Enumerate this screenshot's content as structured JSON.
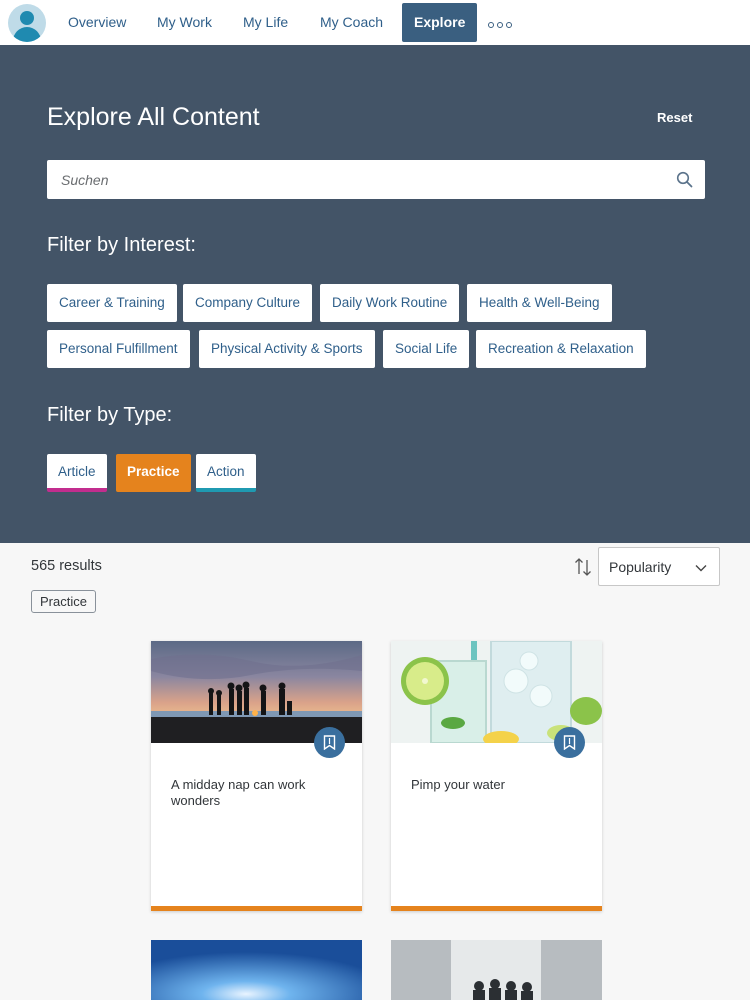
{
  "nav": {
    "tabs": [
      {
        "label": "Overview"
      },
      {
        "label": "My Work"
      },
      {
        "label": "My Life"
      },
      {
        "label": "My Coach"
      },
      {
        "label": "Explore"
      }
    ],
    "active_tab": "Explore",
    "more_icon": "overflow-dots-icon"
  },
  "hero": {
    "title": "Explore All Content",
    "reset_label": "Reset",
    "search": {
      "placeholder": "Suchen",
      "value": ""
    },
    "interest_label": "Filter by Interest:",
    "interests": [
      "Career & Training",
      "Company Culture",
      "Daily Work Routine",
      "Health & Well-Being",
      "Personal Fulfillment",
      "Physical Activity & Sports",
      "Social Life",
      "Recreation & Relaxation"
    ],
    "type_label": "Filter by Type:",
    "types": [
      {
        "label": "Article",
        "color": "#c22d8e",
        "selected": false
      },
      {
        "label": "Practice",
        "color": "#e5831d",
        "selected": true
      },
      {
        "label": "Action",
        "color": "#1f9ab1",
        "selected": false
      }
    ]
  },
  "results": {
    "count_label": "565 results",
    "sort_value": "Popularity",
    "active_filter_token": "Practice"
  },
  "cards": [
    {
      "title": "A midday nap can work wonders",
      "type_color": "#e5831d"
    },
    {
      "title": "Pimp your water",
      "type_color": "#e5831d"
    }
  ],
  "colors": {
    "hero_bg": "#435467",
    "accent_blue": "#3a5f80",
    "practice_orange": "#e5831d"
  }
}
